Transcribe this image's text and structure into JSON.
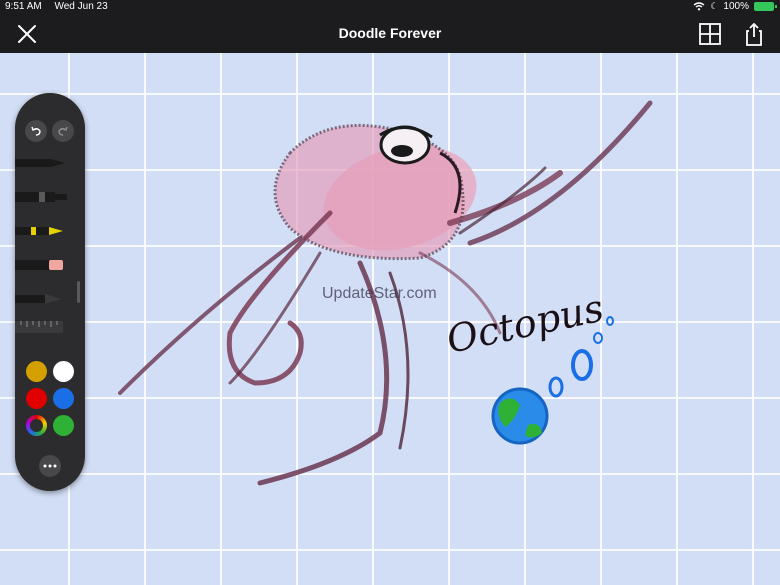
{
  "status_bar": {
    "time": "9:51 AM",
    "date": "Wed Jun 23",
    "battery": "100%"
  },
  "nav": {
    "title": "Doodle Forever",
    "close_icon": "close-icon",
    "grid_icon": "grid-icon",
    "share_icon": "share-icon"
  },
  "canvas": {
    "background": "#d2def6",
    "watermark": "UpdateStar.com",
    "handwriting": "Octopus"
  },
  "palette": {
    "undo_icon": "undo-icon",
    "redo_icon": "redo-icon",
    "tools": [
      "pen",
      "marker",
      "pencil",
      "eraser",
      "crayon",
      "ruler"
    ],
    "colors": [
      {
        "name": "yellow",
        "hex": "#d4a000"
      },
      {
        "name": "white",
        "hex": "#ffffff"
      },
      {
        "name": "red",
        "hex": "#e00000"
      },
      {
        "name": "blue",
        "hex": "#1a6fe6"
      },
      {
        "name": "multicolor",
        "hex": "spectrum"
      },
      {
        "name": "green",
        "hex": "#2eb135"
      }
    ],
    "more_icon": "more-icon"
  }
}
